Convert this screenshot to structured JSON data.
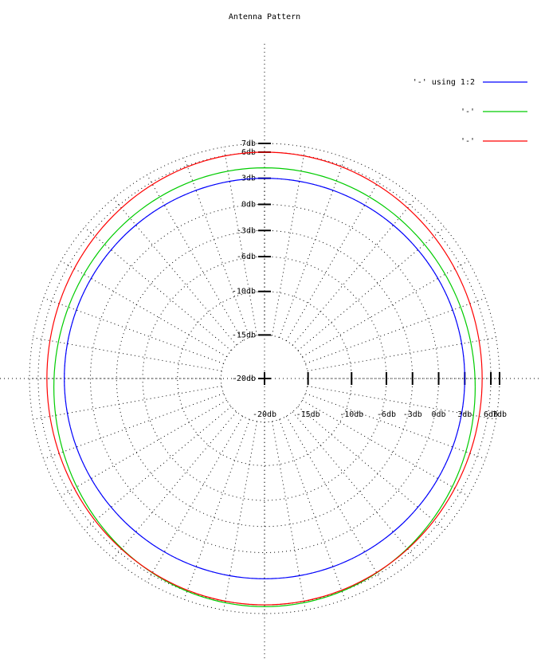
{
  "chart_data": {
    "type": "polar-line",
    "title": "Antenna Pattern",
    "radial_ticks": [
      "-20db",
      "-15db",
      "-10db",
      "-6db",
      "-3db",
      "0db",
      "3db",
      "6db",
      "7db"
    ],
    "radial_range_db": [
      -20,
      7
    ],
    "grid": true,
    "angular_grid_step_deg": 10,
    "legend_position": "top-right",
    "series": [
      {
        "name": "'-' using 1:2",
        "color": "#0000ff",
        "shape": "circle",
        "max_db": 3.0,
        "min_db": 3.0,
        "center_offset_db": 0.0
      },
      {
        "name": "'-'",
        "color": "#00cc00",
        "shape": "ellipse",
        "max_db": 5.2,
        "min_db": 4.2,
        "center_offset_db": -1.0
      },
      {
        "name": "'-'",
        "color": "#ff0000",
        "shape": "ellipse",
        "max_db": 6.0,
        "min_db": 5.0,
        "center_offset_db": 0.0
      }
    ]
  }
}
